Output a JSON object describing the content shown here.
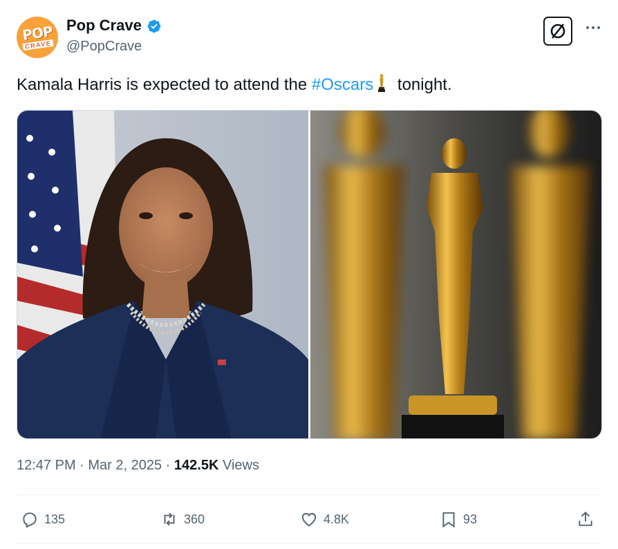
{
  "account": {
    "name": "Pop Crave",
    "handle": "@PopCrave",
    "avatar_text_top": "POP",
    "avatar_text_bottom": "CRAVE",
    "verified": true
  },
  "tweet": {
    "text_before": "Kamala Harris is expected to attend the ",
    "hashtag": "#Oscars",
    "text_after": " tonight.",
    "emoji": "oscar-trophy-icon"
  },
  "meta": {
    "time": "12:47 PM",
    "separator": " · ",
    "date": "Mar 2, 2025",
    "views_count": "142.5K",
    "views_label": " Views"
  },
  "actions": {
    "replies": "135",
    "reposts": "360",
    "likes": "4.8K",
    "bookmarks": "93"
  },
  "colors": {
    "accent": "#1d9bf0",
    "secondary_text": "#536471",
    "primary_text": "#0f1419"
  },
  "icons": [
    "verified-badge-icon",
    "grok-icon",
    "more-icon",
    "reply-icon",
    "repost-icon",
    "like-icon",
    "bookmark-icon",
    "share-icon"
  ]
}
